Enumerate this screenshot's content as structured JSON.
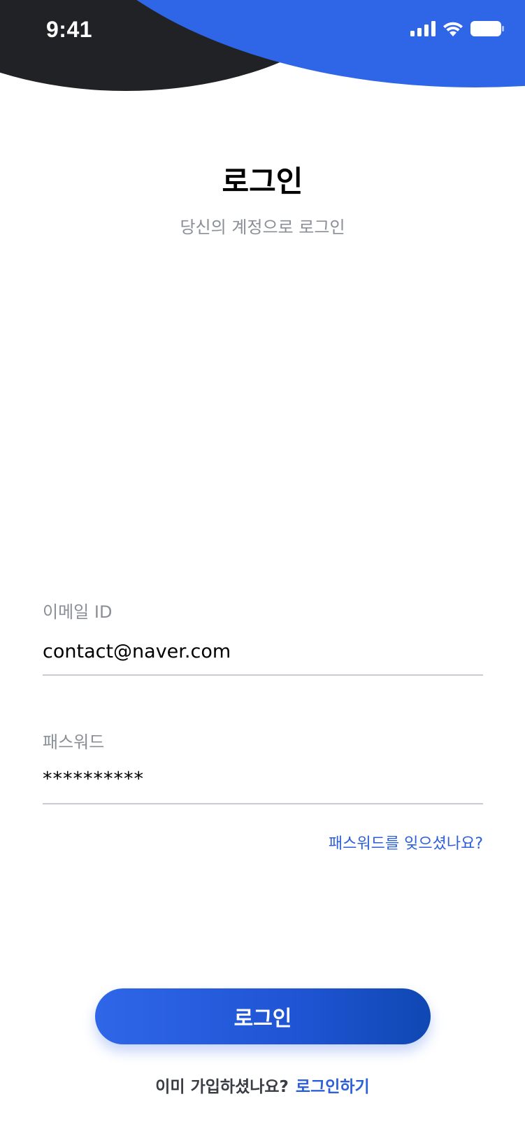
{
  "status_bar": {
    "time": "9:41",
    "icons": [
      "signal-icon",
      "wifi-icon",
      "battery-icon"
    ]
  },
  "header": {
    "title": "로그인",
    "subtitle": "당신의 계정으로 로그인"
  },
  "form": {
    "email": {
      "label": "이메일 ID",
      "value": "contact@naver.com"
    },
    "password": {
      "label": "패스워드",
      "value": "**********"
    },
    "forgot_password": "패스워드를 잊으셨나요?"
  },
  "actions": {
    "login_button": "로그인"
  },
  "footer": {
    "question": "이미 가입하셨나요?",
    "link": "로그인하기"
  },
  "colors": {
    "accent": "#2f66e8",
    "link": "#2c5fd8",
    "dark_shape": "#212225",
    "muted_text": "#8a8e96",
    "divider": "#c9ccd6"
  }
}
